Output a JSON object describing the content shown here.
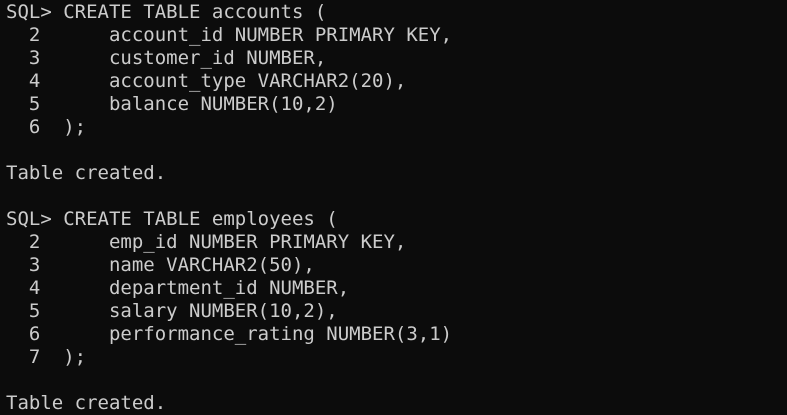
{
  "terminal": {
    "background": "#0c0c0c",
    "foreground": "#cccccc",
    "lines": [
      "SQL> CREATE TABLE accounts (",
      "  2      account_id NUMBER PRIMARY KEY,",
      "  3      customer_id NUMBER,",
      "  4      account_type VARCHAR2(20),",
      "  5      balance NUMBER(10,2)",
      "  6  );",
      "",
      "Table created.",
      "",
      "SQL> CREATE TABLE employees (",
      "  2      emp_id NUMBER PRIMARY KEY,",
      "  3      name VARCHAR2(50),",
      "  4      department_id NUMBER,",
      "  5      salary NUMBER(10,2),",
      "  6      performance_rating NUMBER(3,1)",
      "  7  );",
      "",
      "Table created."
    ]
  }
}
